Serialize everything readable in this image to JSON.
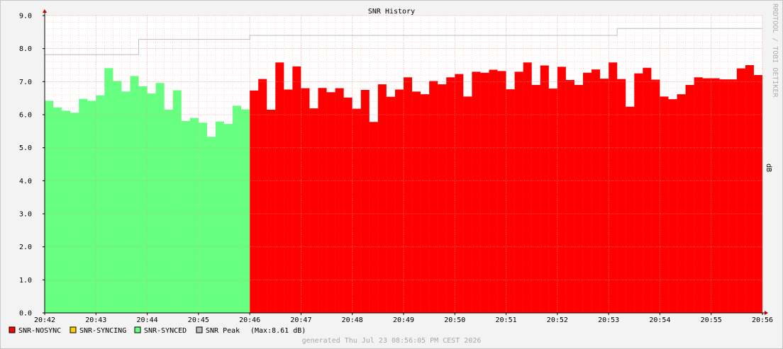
{
  "chart_data": {
    "type": "area",
    "title": "SNR History",
    "ylabel": "dB",
    "watermark": "RRDTOOL / TOBI OETIKER",
    "ylim": [
      0,
      9
    ],
    "yticks": [
      "0.0",
      "1.0",
      "2.0",
      "3.0",
      "4.0",
      "5.0",
      "6.0",
      "7.0",
      "8.0",
      "9.0"
    ],
    "xticks": [
      "20:42",
      "20:43",
      "20:44",
      "20:45",
      "20:46",
      "20:47",
      "20:48",
      "20:49",
      "20:50",
      "20:51",
      "20:52",
      "20:53",
      "20:54",
      "20:55",
      "20:56"
    ],
    "grid": true,
    "colors": {
      "nosync": "#ff0000",
      "syncing": "#ffcc00",
      "synced": "#66ff80",
      "peak": "#bdbdbd"
    },
    "series": [
      {
        "name": "SNR-SYNCED",
        "values": [
          6.42,
          6.22,
          6.12,
          6.06,
          6.48,
          6.42,
          6.58,
          7.41,
          7.02,
          6.7,
          7.17,
          6.86,
          6.64,
          6.96,
          6.15,
          6.74,
          5.81,
          5.9,
          5.76,
          5.33,
          5.79,
          5.72,
          6.27,
          6.16
        ]
      },
      {
        "name": "SNR-SYNCING",
        "values": []
      },
      {
        "name": "SNR-NOSYNC",
        "values": [
          6.73,
          7.08,
          6.15,
          7.58,
          6.76,
          7.46,
          6.8,
          6.19,
          6.81,
          6.68,
          6.8,
          6.52,
          6.18,
          6.75,
          5.78,
          6.92,
          6.54,
          6.76,
          7.13,
          6.7,
          6.62,
          7.02,
          6.92,
          7.13,
          7.23,
          6.55,
          7.3,
          7.27,
          7.36,
          7.32,
          6.77,
          7.3,
          7.58,
          6.9,
          7.49,
          6.79,
          7.45,
          7.05,
          6.9,
          7.27,
          7.37,
          7.09,
          7.58,
          7.08,
          6.24,
          7.25,
          7.42,
          7.06,
          6.55,
          6.47,
          6.62,
          6.9,
          7.13,
          7.1,
          7.1,
          7.07,
          7.07,
          7.4,
          7.5,
          7.2
        ]
      },
      {
        "name": "SNR Peak",
        "steps": [
          {
            "from": "20:42",
            "to": "20:43:50",
            "value": 7.82
          },
          {
            "from": "20:43:50",
            "to": "20:46",
            "value": 8.28
          },
          {
            "from": "20:46",
            "to": "20:53:10",
            "value": 8.4
          },
          {
            "from": "20:53:10",
            "to": "20:56",
            "value": 8.61
          }
        ]
      }
    ],
    "legend": [
      {
        "label": "SNR-NOSYNC",
        "color": "#ff0000"
      },
      {
        "label": "SNR-SYNCING",
        "color": "#ffcc00"
      },
      {
        "label": "SNR-SYNCED",
        "color": "#66ff80"
      },
      {
        "label": "SNR Peak",
        "color": "#bdbdbd"
      }
    ],
    "peak_note": "(Max:8.61 dB)"
  },
  "footer": "generated Thu Jul 23 08:56:05 PM CEST 2026"
}
